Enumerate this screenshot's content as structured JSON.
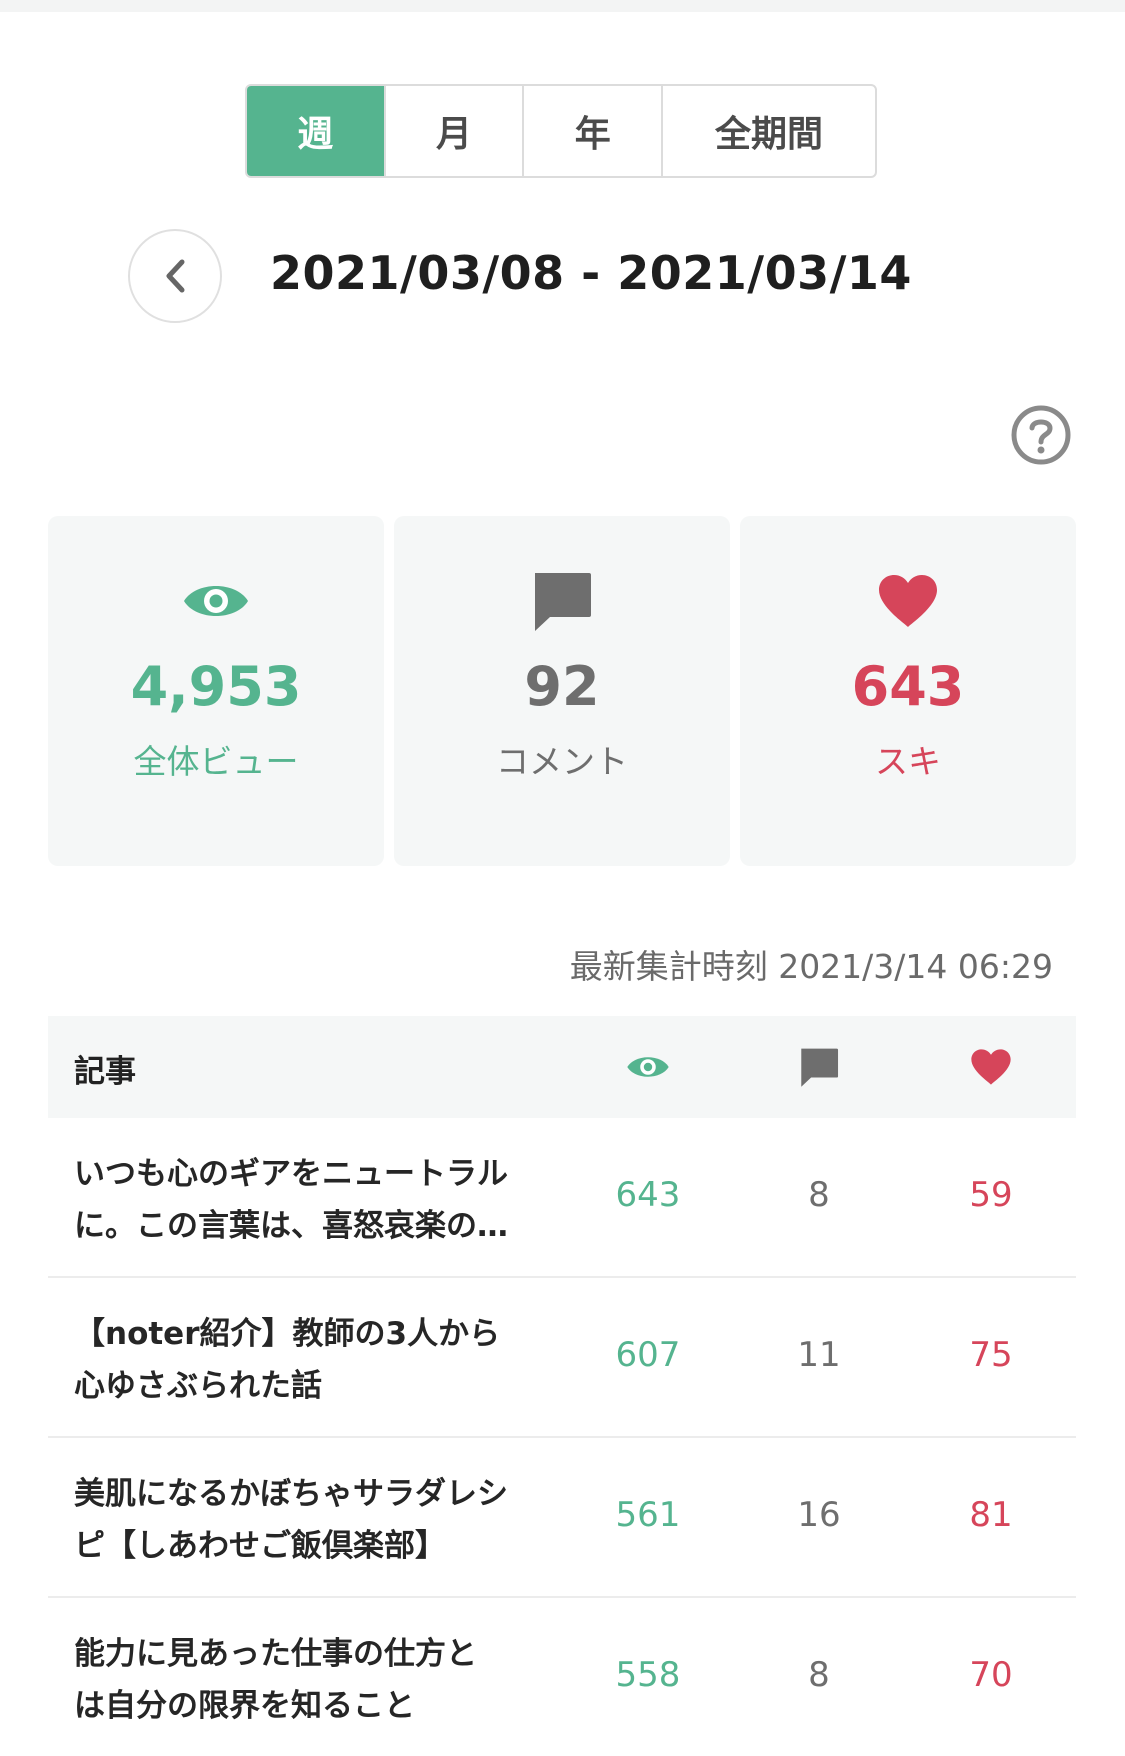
{
  "period_tabs": [
    "週",
    "月",
    "年",
    "全期間"
  ],
  "date_range": "2021/03/08 - 2021/03/14",
  "summary": {
    "views": {
      "value": "4,953",
      "label": "全体ビュー"
    },
    "comments": {
      "value": "92",
      "label": "コメント"
    },
    "likes": {
      "value": "643",
      "label": "スキ"
    }
  },
  "timestamp": "最新集計時刻 2021/3/14 06:29",
  "table": {
    "header_title": "記事",
    "rows": [
      {
        "title_line1": "いつも心のギアをニュートラル",
        "title_line2": "に。この言葉は、喜怒哀楽の…",
        "views": "643",
        "comments": "8",
        "likes": "59"
      },
      {
        "title_line1": "【noter紹介】教師の3人から",
        "title_line2": "心ゆさぶられた話",
        "views": "607",
        "comments": "11",
        "likes": "75"
      },
      {
        "title_line1": "美肌になるかぼちゃサラダレシ",
        "title_line2": "ピ【しあわせご飯倶楽部】",
        "views": "561",
        "comments": "16",
        "likes": "81"
      },
      {
        "title_line1": "能力に見あった仕事の仕方と",
        "title_line2": "は自分の限界を知ること",
        "views": "558",
        "comments": "8",
        "likes": "70"
      }
    ]
  },
  "colors": {
    "accent": "#55b48f",
    "like": "#d6455a",
    "comment": "#6e6e6e"
  }
}
